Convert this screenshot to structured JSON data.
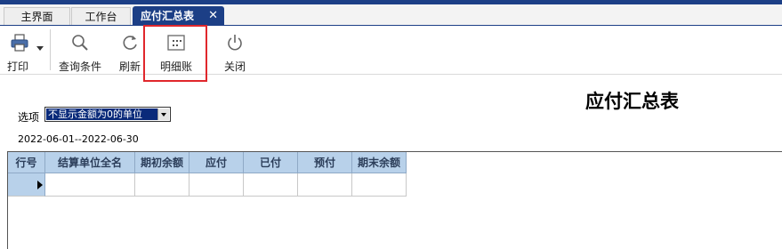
{
  "tabs": [
    {
      "label": "主界面"
    },
    {
      "label": "工作台"
    },
    {
      "label": "应付汇总表",
      "close": "✕"
    }
  ],
  "toolbar": {
    "print": "打印",
    "query": "查询条件",
    "refresh": "刷新",
    "detail": "明细账",
    "close": "关闭"
  },
  "report": {
    "title": "应付汇总表",
    "options_label": "选项",
    "options_selected": "不显示金额为0的单位",
    "date_range": "2022-06-01--2022-06-30"
  },
  "grid": {
    "columns": [
      "行号",
      "结算单位全名",
      "期初余额",
      "应付",
      "已付",
      "预付",
      "期末余额"
    ],
    "rows": [
      [
        "",
        "",
        "",
        "",
        "",
        "",
        ""
      ]
    ]
  },
  "colors": {
    "accent": "#1c3f86",
    "header": "#b8d1ea",
    "highlight": "#e0272c"
  },
  "icons": [
    "printer-icon",
    "dropdown-arrow-icon",
    "magnifier-icon",
    "refresh-icon",
    "detail-grid-icon",
    "power-icon",
    "close-icon",
    "row-pointer-icon"
  ]
}
